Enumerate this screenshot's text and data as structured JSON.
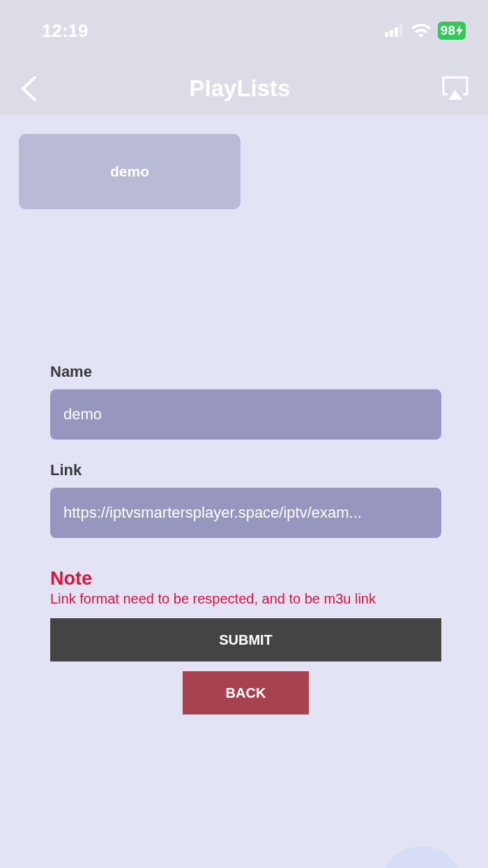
{
  "status_bar": {
    "time": "12:19",
    "battery": "98"
  },
  "nav_bar": {
    "title": "PlayLists"
  },
  "playlists": [
    {
      "name": "demo"
    }
  ],
  "form": {
    "fields": [
      {
        "label": "Name",
        "value": "demo"
      },
      {
        "label": "Link",
        "value": "https://iptvsmartersplayer.space/iptv/exam..."
      }
    ],
    "note_title": "Note",
    "note_text": "Link format need to be respected, and to be m3u link",
    "submit": "SUBMIT",
    "back": "BACK"
  }
}
